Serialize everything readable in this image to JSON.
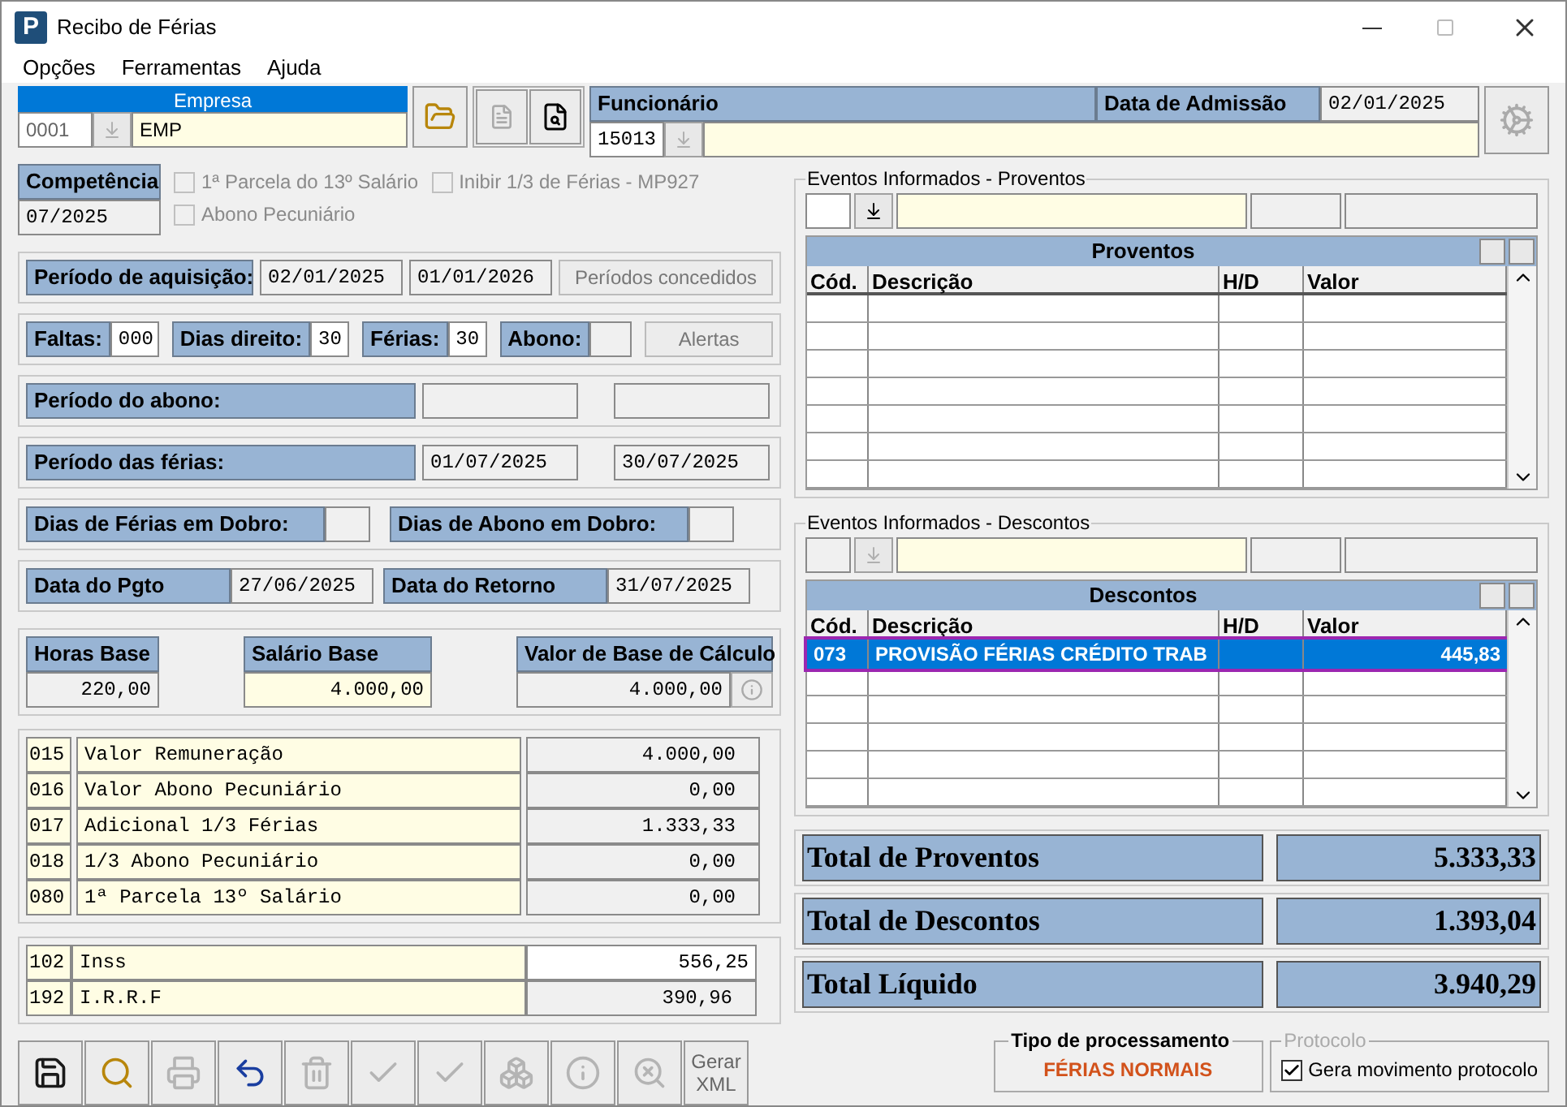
{
  "window": {
    "title": "Recibo de Férias",
    "logo": "P"
  },
  "menu": [
    "Opções",
    "Ferramentas",
    "Ajuda"
  ],
  "empresa": {
    "label": "Empresa",
    "code": "0001",
    "name": "EMP"
  },
  "funcionario": {
    "label": "Funcionário",
    "code": "15013"
  },
  "admissao": {
    "label": "Data de Admissão",
    "value": "02/01/2025"
  },
  "competencia": {
    "label": "Competência",
    "value": "07/2025"
  },
  "options": [
    {
      "label": "1ª Parcela do 13º Salário",
      "checked": false,
      "disabled": true
    },
    {
      "label": "Abono Pecuniário",
      "checked": false,
      "disabled": true
    },
    {
      "label": "Inibir 1/3 de Férias - MP927",
      "checked": false,
      "disabled": true
    }
  ],
  "aquisicao": {
    "label": "Período de aquisição:",
    "start": "02/01/2025",
    "end": "01/01/2026",
    "button": "Períodos concedidos"
  },
  "counts": [
    {
      "label": "Faltas:",
      "value": "000"
    },
    {
      "label": "Dias direito:",
      "value": "30"
    },
    {
      "label": "Férias:",
      "value": "30"
    },
    {
      "label": "Abono:"
    }
  ],
  "alert_button": "Alertas",
  "abono_period": {
    "label": "Período do abono:"
  },
  "ferias_period": {
    "label": "Período das férias:",
    "start": "01/07/2025",
    "end": "30/07/2025"
  },
  "dobro": [
    {
      "label": "Dias de Férias em Dobro:"
    },
    {
      "label": "Dias de Abono em Dobro:"
    }
  ],
  "dates": [
    {
      "label": "Data do Pgto",
      "value": "27/06/2025"
    },
    {
      "label": "Data do Retorno",
      "value": "31/07/2025"
    }
  ],
  "bases": [
    {
      "label": "Horas Base",
      "value": "220,00"
    },
    {
      "label": "Salário Base",
      "value": "4.000,00"
    },
    {
      "label": "Valor de Base de Cálculo",
      "value": "4.000,00"
    }
  ],
  "earnings": [
    {
      "code": "015",
      "description": "Valor Remuneração",
      "value": "4.000,00"
    },
    {
      "code": "016",
      "description": "Valor Abono Pecuniário",
      "value": "0,00"
    },
    {
      "code": "017",
      "description": "Adicional 1/3 Férias",
      "value": "1.333,33"
    },
    {
      "code": "018",
      "description": "1/3 Abono Pecuniário",
      "value": "0,00"
    },
    {
      "code": "080",
      "description": "1ª Parcela 13º Salário",
      "value": "0,00"
    }
  ],
  "deductions": [
    {
      "code": "102",
      "description": "Inss",
      "value": "556,25"
    },
    {
      "code": "192",
      "description": "I.R.R.F",
      "value": "390,96"
    }
  ],
  "toolbar": [
    {
      "disabled": false
    },
    {
      "disabled": false
    },
    {
      "disabled": true
    },
    {
      "disabled": false
    },
    {
      "disabled": true
    },
    {
      "disabled": true
    },
    {
      "disabled": true
    },
    {
      "disabled": true
    },
    {
      "disabled": true
    },
    {
      "disabled": true
    },
    {
      "label": "Gerar XML",
      "disabled": true
    }
  ],
  "proventos": {
    "legend": "Eventos Informados - Proventos",
    "title": "Proventos",
    "columns": [
      "Cód.",
      "Descrição",
      "H/D",
      "Valor"
    ]
  },
  "descontos": {
    "legend": "Eventos Informados - Descontos",
    "title": "Descontos",
    "columns": [
      "Cód.",
      "Descrição",
      "H/D",
      "Valor"
    ],
    "rows": [
      {
        "code": "073",
        "description": "PROVISÃO FÉRIAS CRÉDITO TRAB",
        "value": "445,83",
        "selected": true
      }
    ]
  },
  "totals": [
    {
      "label": "Total de Proventos",
      "value": "5.333,33"
    },
    {
      "label": "Total de Descontos",
      "value": "1.393,04"
    },
    {
      "label": "Total Líquido",
      "value": "3.940,29"
    }
  ],
  "processing": {
    "label": "Tipo de processamento",
    "value": "FÉRIAS NORMAIS"
  },
  "protocolo": {
    "legend": "Protocolo",
    "option": "Gera movimento protocolo",
    "checked": true
  }
}
